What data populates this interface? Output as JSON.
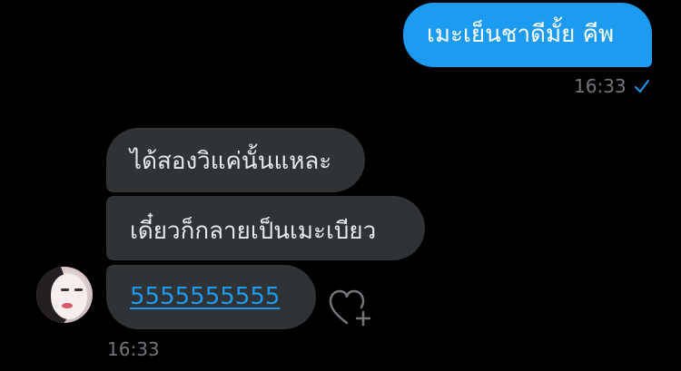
{
  "conversation": {
    "sent_message": {
      "text": "เมะเย็นชาดีมั้ย คีพ",
      "time": "16:33",
      "status_icon": "checkmark-icon"
    },
    "received_messages": [
      {
        "text": "ได้สองวิแค่นั้นแหละ"
      },
      {
        "text": "เดี๋ยวก็กลายเป็นเมะเบียว"
      },
      {
        "text": "5555555555",
        "is_link": true
      }
    ],
    "received_time": "16:33",
    "react_icon": "heart-plus-icon",
    "avatar_icon": "avatar-photo"
  },
  "colors": {
    "background": "#000000",
    "sent_bubble": "#1d9bf0",
    "received_bubble": "#2f3336",
    "link": "#1d9bf0",
    "timestamp": "#71767b"
  }
}
